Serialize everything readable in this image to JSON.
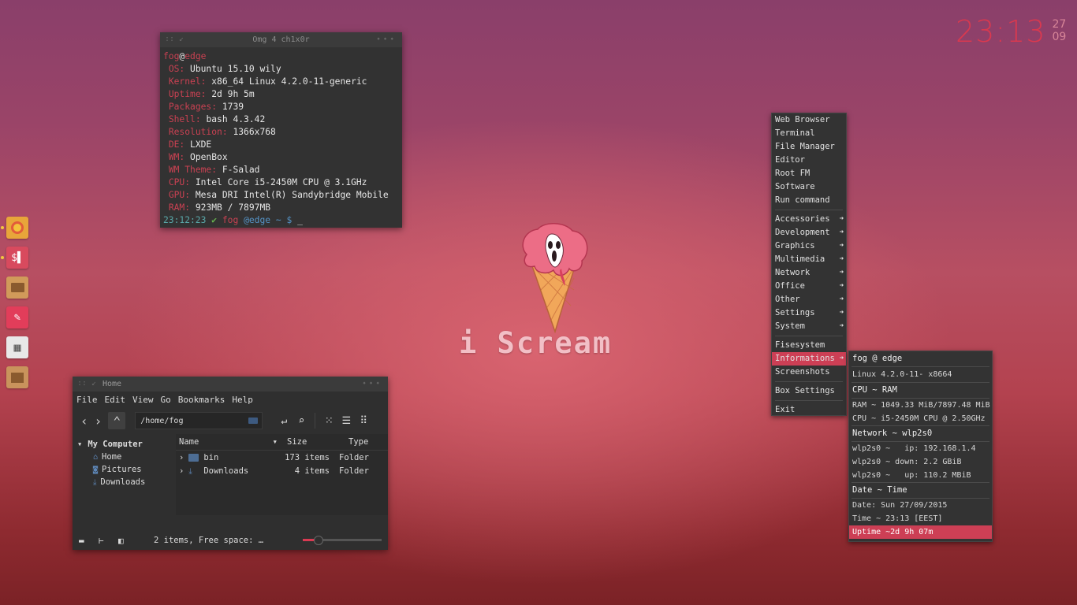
{
  "clock": {
    "time": "23:13",
    "day": "27",
    "month": "09"
  },
  "terminal": {
    "title": "Omg 4 ch1x0r",
    "user": "fog",
    "at": "@",
    "host": "edge",
    "info": [
      {
        "label": "OS:",
        "value": "Ubuntu 15.10 wily"
      },
      {
        "label": "Kernel:",
        "value": "x86_64 Linux 4.2.0-11-generic"
      },
      {
        "label": "Uptime:",
        "value": "2d 9h 5m"
      },
      {
        "label": "Packages:",
        "value": "1739"
      },
      {
        "label": "Shell:",
        "value": "bash 4.3.42"
      },
      {
        "label": "Resolution:",
        "value": "1366x768"
      },
      {
        "label": "DE:",
        "value": "LXDE"
      },
      {
        "label": "WM:",
        "value": "OpenBox"
      },
      {
        "label": "WM Theme:",
        "value": "F-Salad"
      },
      {
        "label": "CPU:",
        "value": "Intel Core i5-2450M CPU @ 3.1GHz"
      },
      {
        "label": "GPU:",
        "value": "Mesa DRI Intel(R) Sandybridge Mobile"
      },
      {
        "label": "RAM:",
        "value": "923MB / 7897MB"
      }
    ],
    "prompt": {
      "time": "23:12:23",
      "check": "✔",
      "user": "fog",
      "host": "@edge",
      "tilde": "~",
      "dollar": "$",
      "cursor": "_"
    }
  },
  "dock": [
    {
      "name": "chrome",
      "color": "#e8a53a",
      "glyph": "◉"
    },
    {
      "name": "terminal",
      "color": "#d84a5e",
      "glyph": "$"
    },
    {
      "name": "files",
      "color": "#d19a5a",
      "glyph": "▭"
    },
    {
      "name": "editor",
      "color": "#e23d5a",
      "glyph": "✎"
    },
    {
      "name": "calculator",
      "color": "#e8e8e8",
      "glyph": "▦"
    },
    {
      "name": "archive",
      "color": "#c9935c",
      "glyph": "▤"
    }
  ],
  "wallpaper": {
    "caption": "i Scream"
  },
  "filemanager": {
    "title": "Home",
    "menus": [
      "File",
      "Edit",
      "View",
      "Go",
      "Bookmarks",
      "Help"
    ],
    "path": "/home/fog",
    "sidebar": {
      "header": "My Computer",
      "items": [
        "Home",
        "Pictures",
        "Downloads"
      ]
    },
    "columns": {
      "name": "Name",
      "size": "Size",
      "type": "Type"
    },
    "rows": [
      {
        "name": "bin",
        "size": "173 items",
        "type": "Folder"
      },
      {
        "name": "Downloads",
        "size": "4 items",
        "type": "Folder"
      }
    ],
    "status": "2 items, Free space: …",
    "zoom_fraction": 0.15
  },
  "menu": {
    "items1": [
      "Web Browser",
      "Terminal",
      "File Manager",
      "Editor",
      "Root FM",
      "Software",
      "Run command"
    ],
    "items2": [
      "Accessories",
      "Development",
      "Graphics",
      "Multimedia",
      "Network",
      "Office",
      "Other",
      "Settings",
      "System"
    ],
    "items3": [
      "Fisesystem",
      "Informations",
      "Screenshots"
    ],
    "items4": [
      "Box Settings"
    ],
    "exit": "Exit"
  },
  "submenu": {
    "h1": "fog @ edge",
    "kernel": "Linux 4.2.0-11- x8664",
    "h2": "CPU ~ RAM",
    "ram": "RAM ~ 1049.33 MiB/7897.48 MiB",
    "cpu": "CPU ~ i5-2450M CPU @ 2.50GHz",
    "h3": "Network ~ wlp2s0",
    "ip": "wlp2s0 ~   ip: 192.168.1.4",
    "down": "wlp2s0 ~ down: 2.2 GBiB",
    "up": "wlp2s0 ~   up: 110.2 MBiB",
    "h4": "Date ~ Time",
    "date": "Date: Sun 27/09/2015",
    "time": "Time ~ 23:13 [EEST]",
    "uptime": "Uptime ~2d 9h 07m"
  }
}
